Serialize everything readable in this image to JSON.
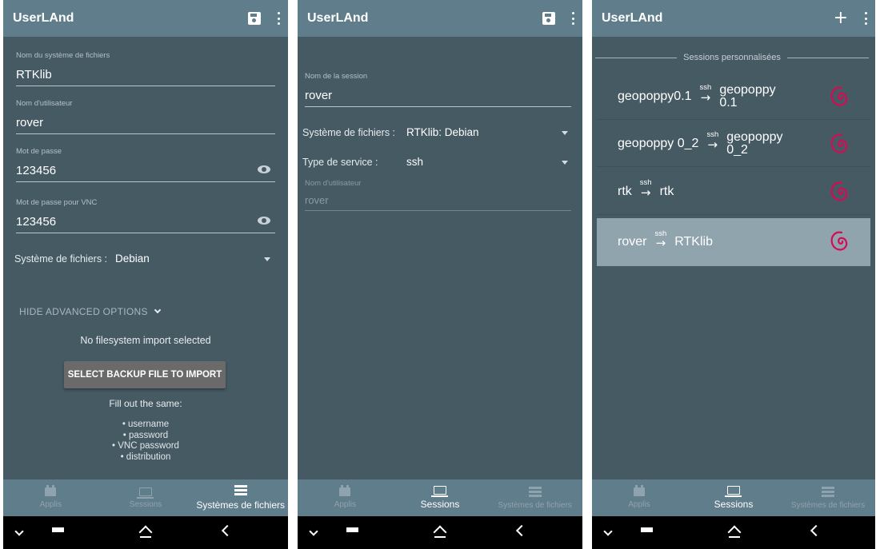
{
  "screens": [
    {
      "app_title": "UserLAnd",
      "fields": [
        {
          "label": "Nom du système de fichiers",
          "value": "RTKlib"
        },
        {
          "label": "Nom d'utilisateur",
          "value": "rover"
        },
        {
          "label": "Mot de passe",
          "value": "123456"
        },
        {
          "label": "Mot de passe pour VNC",
          "value": "123456"
        }
      ],
      "fs_dropdown": {
        "label": "Système de fichiers :",
        "value": "Debian"
      },
      "advanced_toggle": "HIDE ADVANCED OPTIONS",
      "no_import_text": "No filesystem import selected",
      "backup_button": "SELECT BACKUP FILE TO IMPORT",
      "fill_out_text": "Fill out the same:",
      "bullets": [
        "• username",
        "• password",
        "• VNC password",
        "• distribution"
      ]
    },
    {
      "app_title": "UserLAnd",
      "session_name": {
        "label": "Nom de la session",
        "value": "rover"
      },
      "fs_dropdown": {
        "label": "Système de fichiers :",
        "value": "RTKlib: Debian"
      },
      "service_dropdown": {
        "label": "Type de service :",
        "value": "ssh"
      },
      "username": {
        "label": "Nom d'utilisateur",
        "value": "rover"
      }
    },
    {
      "app_title": "UserLAnd",
      "section_header": "Sessions personnalisées",
      "sessions": [
        {
          "user": "geopoppy0.1",
          "service": "ssh",
          "fs_line1": "geopoppy",
          "fs_line2": "0.1"
        },
        {
          "user": "geopoppy 0_2",
          "service": "ssh",
          "fs_line1": "geopoppy",
          "fs_line2": "0_2"
        },
        {
          "user": "rtk",
          "service": "ssh",
          "fs_line1": "rtk",
          "fs_line2": ""
        },
        {
          "user": "rover",
          "service": "ssh",
          "fs_line1": "RTKlib",
          "fs_line2": ""
        }
      ]
    }
  ],
  "bottom_nav": [
    "Applis",
    "Sessions",
    "Systèmes de fichiers"
  ],
  "arrow_glyph": "→",
  "colors": {
    "background": "#465a64",
    "app_bar": "#607d8b",
    "selected_row": "#90a4ae",
    "debian_red": "#d70a53"
  }
}
